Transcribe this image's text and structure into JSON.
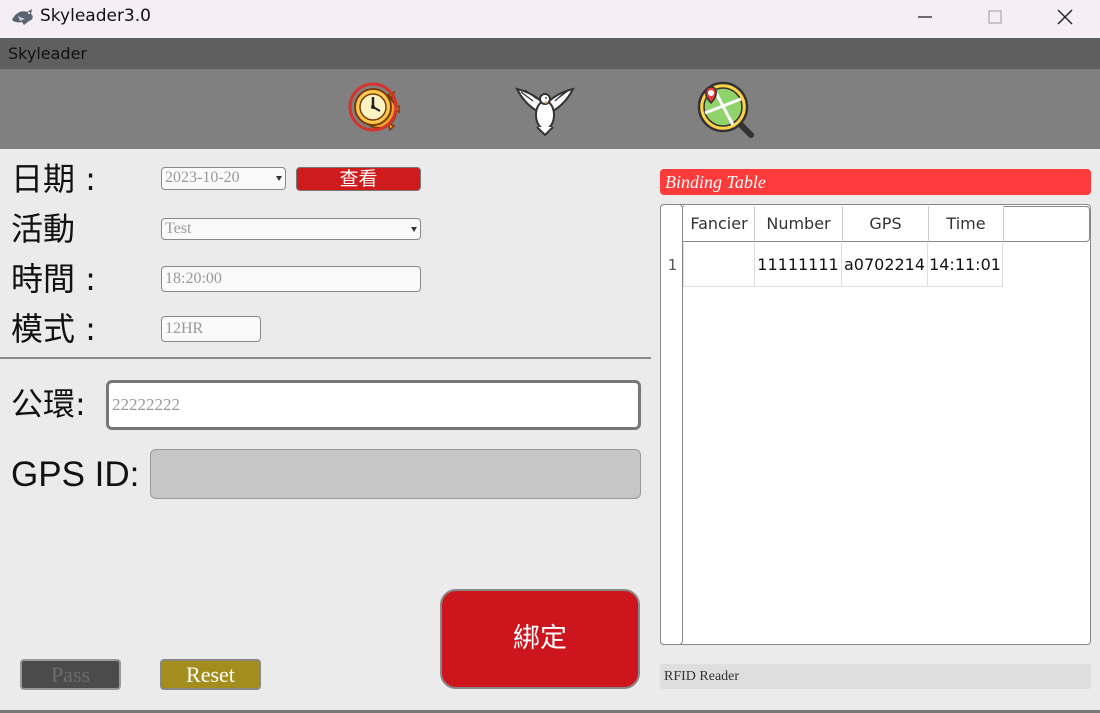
{
  "window": {
    "title": "Skyleader3.0",
    "icon": "pigeon-icon",
    "controls": [
      "minimize-icon",
      "maximize-icon",
      "close-icon"
    ]
  },
  "menubar": {
    "label": "Skyleader"
  },
  "toolbar": {
    "tools": [
      {
        "icon": "clock-gear-icon"
      },
      {
        "icon": "dove-icon"
      },
      {
        "icon": "map-search-icon"
      }
    ]
  },
  "form": {
    "date_label": "日期 :",
    "date_value": "2023-10-20",
    "view_button": "查看",
    "activity_label": "活動",
    "activity_value": "Test",
    "time_label": "時間 :",
    "time_value": "18:20:00",
    "mode_label": "模式 :",
    "mode_value": "12HR",
    "ring_label": "公環:",
    "ring_value": "22222222",
    "gps_label": "GPS ID:",
    "gps_value": ""
  },
  "buttons": {
    "bind": "綁定",
    "pass": "Pass",
    "reset": "Reset"
  },
  "binding_table": {
    "title": "Binding Table",
    "columns": [
      "Fancier",
      "Number",
      "GPS",
      "Time"
    ],
    "rows": [
      {
        "row_number": "1",
        "Fancier": "",
        "Number": "11111111",
        "GPS": "a0702214",
        "Time": "14:11:01"
      }
    ]
  },
  "status": {
    "rfid": "RFID Reader"
  },
  "colors": {
    "primary_red": "#cc151d",
    "binding_header": "#ff3a3a",
    "reset_gold": "#a38d1c",
    "toolbar_gray": "#808080"
  }
}
